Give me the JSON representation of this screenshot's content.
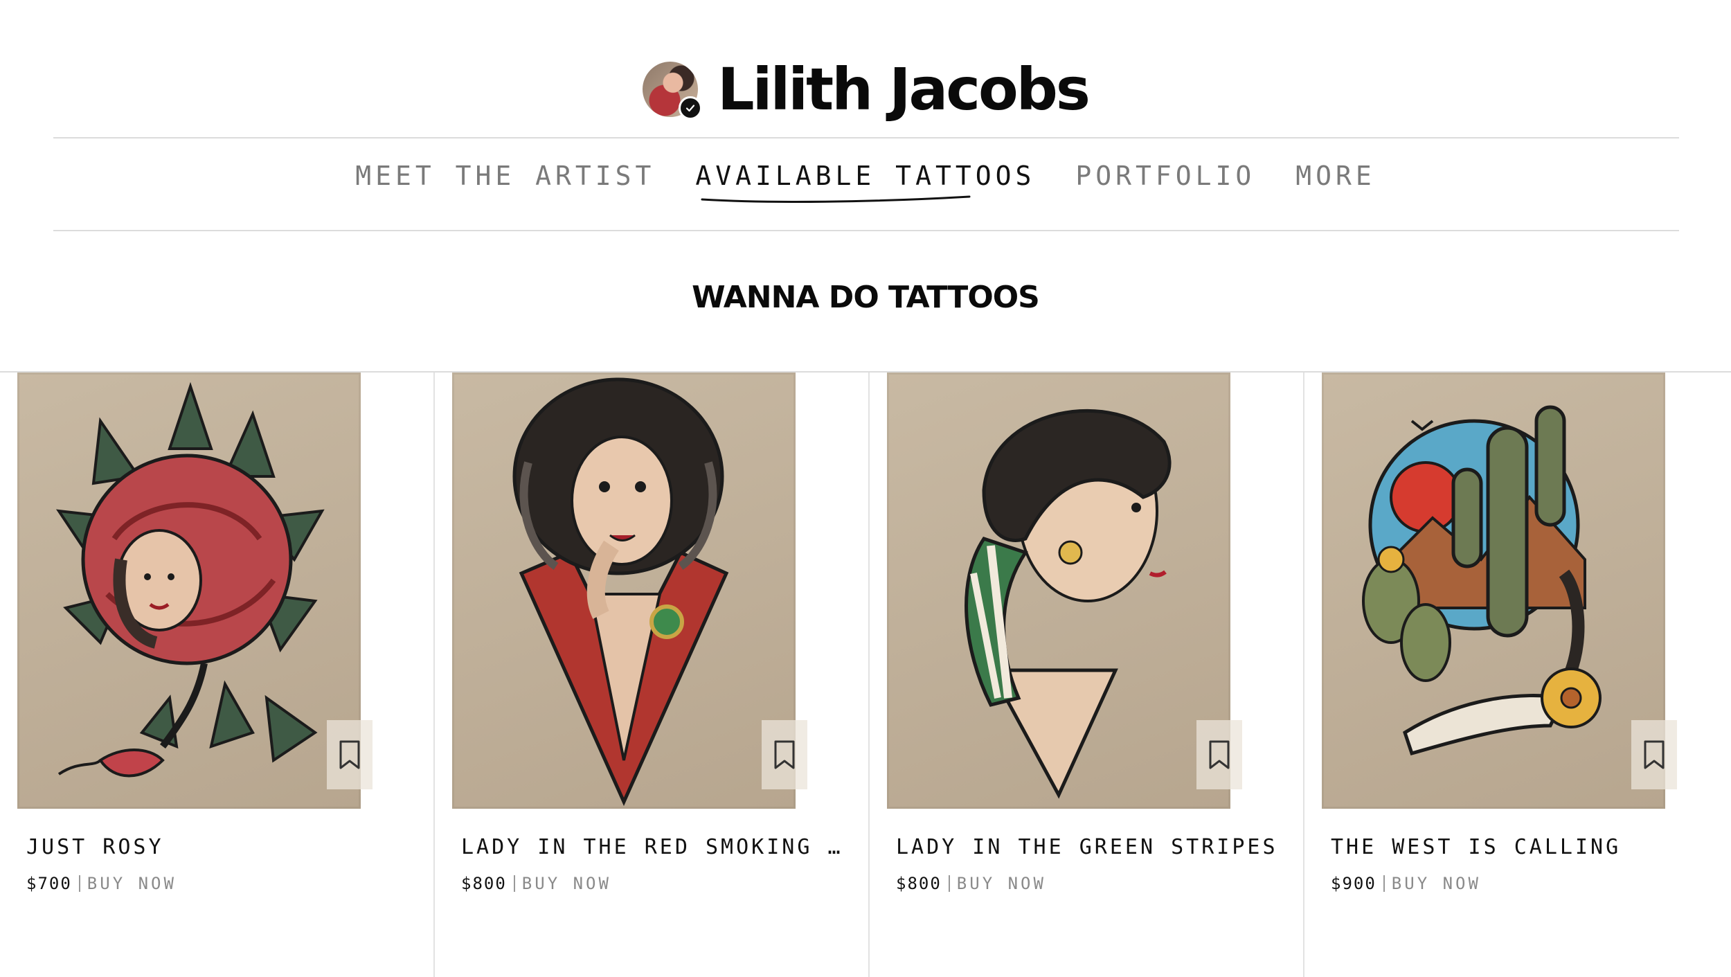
{
  "brand": {
    "name": "Lilith Jacobs",
    "avatar_icon": "avatar-photo",
    "verified_icon": "check-icon"
  },
  "nav": {
    "items": [
      {
        "label": "MEET THE ARTIST",
        "active": false
      },
      {
        "label": "AVAILABLE TATTOOS",
        "active": true
      },
      {
        "label": "PORTFOLIO",
        "active": false
      },
      {
        "label": "MORE",
        "active": false
      }
    ]
  },
  "section": {
    "title": "WANNA DO TATTOOS"
  },
  "products": [
    {
      "title": "JUST ROSY",
      "price": "$700",
      "buy_label": "BUY NOW",
      "bookmark_icon": "bookmark-icon"
    },
    {
      "title": "LADY IN THE RED SMOKING JA…",
      "price": "$800",
      "buy_label": "BUY NOW",
      "bookmark_icon": "bookmark-icon"
    },
    {
      "title": "LADY IN THE GREEN STRIPES",
      "price": "$800",
      "buy_label": "BUY NOW",
      "bookmark_icon": "bookmark-icon"
    },
    {
      "title": "THE WEST IS CALLING",
      "price": "$900",
      "buy_label": "BUY NOW",
      "bookmark_icon": "bookmark-icon"
    }
  ],
  "colors": {
    "text": "#111111",
    "muted": "#7a7a7a",
    "rule": "#dcdcdc",
    "art_bg": "#c8b9a3"
  }
}
